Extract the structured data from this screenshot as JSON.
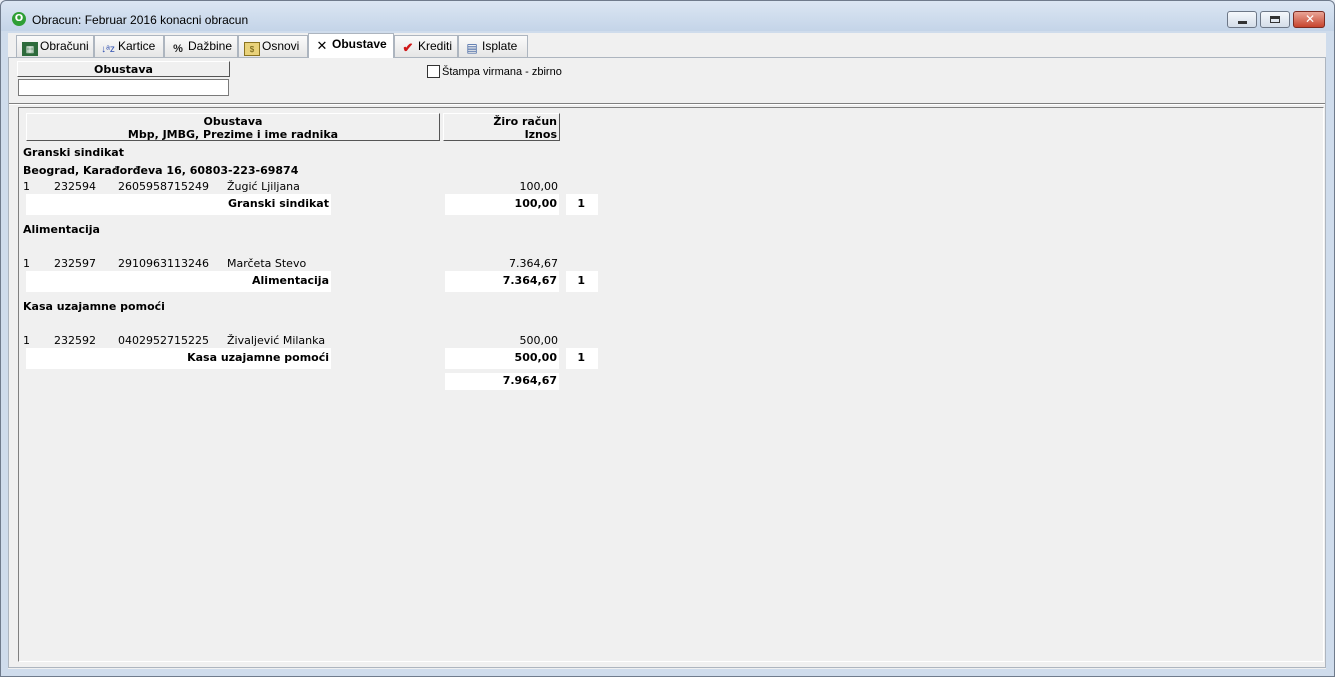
{
  "window": {
    "title": "Obracun: Februar 2016 konacni obracun"
  },
  "tabs": [
    {
      "label": "Obračuni",
      "icon": "calculator-icon"
    },
    {
      "label": "Kartice",
      "icon": "sort-az-icon"
    },
    {
      "label": "Dažbine",
      "icon": "percent-icon"
    },
    {
      "label": "Osnovi",
      "icon": "money-icon"
    },
    {
      "label": "Obustave",
      "icon": "cross-icon"
    },
    {
      "label": "Krediti",
      "icon": "checkmark-icon"
    },
    {
      "label": "Isplate",
      "icon": "documents-icon"
    }
  ],
  "filter": {
    "header": "Obustava",
    "value": ""
  },
  "checkbox": {
    "label": "Štampa virmana - zbirno",
    "checked": false
  },
  "report": {
    "header_col1_line1": "Obustava",
    "header_col1_line2": "Mbp, JMBG, Prezime i ime radnika",
    "header_col2_line1": "Žiro račun",
    "header_col2_line2": "Iznos",
    "groups": [
      {
        "name": "Granski sindikat",
        "address": "Beograd, Karađorđeva 16, 60803-223-69874",
        "rows": [
          {
            "rb": "1",
            "mbp": "232594",
            "jmbg": "2605958715249",
            "name": "Žugić Ljiljana",
            "amount": "100,00"
          }
        ],
        "total_label": "Granski sindikat",
        "total": "100,00",
        "count": "1"
      },
      {
        "name": "Alimentacija",
        "address": "",
        "rows": [
          {
            "rb": "1",
            "mbp": "232597",
            "jmbg": "2910963113246",
            "name": "Marčeta Stevo",
            "amount": "7.364,67"
          }
        ],
        "total_label": "Alimentacija",
        "total": "7.364,67",
        "count": "1"
      },
      {
        "name": "Kasa uzajamne pomoći",
        "address": "",
        "rows": [
          {
            "rb": "1",
            "mbp": "232592",
            "jmbg": "0402952715225",
            "name": "Živaljević Milanka",
            "amount": "500,00"
          }
        ],
        "total_label": "Kasa uzajamne pomoći",
        "total": "500,00",
        "count": "1"
      }
    ],
    "grand_total": "7.964,67"
  }
}
